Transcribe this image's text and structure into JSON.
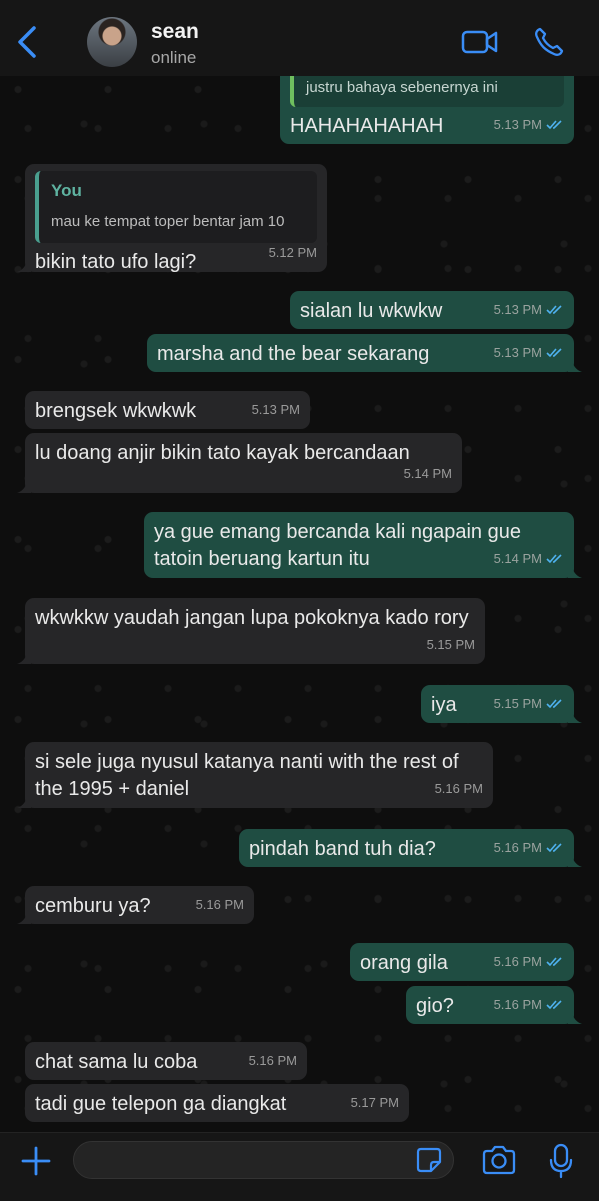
{
  "header": {
    "contact_name": "sean",
    "contact_status": "online"
  },
  "colors": {
    "accent": "#3a8df6",
    "outgoing_bubble": "#1f4d42",
    "incoming_bubble": "#262628",
    "read_ticks": "#4fb2f0"
  },
  "messages": [
    {
      "dir": "out",
      "quote": "justru bahaya sebenernya ini",
      "text": "HAHAHAHAHAH",
      "time": "5.13 PM",
      "status": "read"
    },
    {
      "dir": "in",
      "quote_author": "You",
      "quote": "mau ke tempat toper bentar jam 10",
      "text": "bikin tato ufo lagi?",
      "time": "5.12 PM"
    },
    {
      "dir": "out",
      "text": "sialan lu wkwkw",
      "time": "5.13 PM",
      "status": "read"
    },
    {
      "dir": "out",
      "text": "marsha and the bear sekarang",
      "time": "5.13 PM",
      "status": "read"
    },
    {
      "dir": "in",
      "text": "brengsek wkwkwk",
      "time": "5.13 PM"
    },
    {
      "dir": "in",
      "text": "lu doang anjir bikin tato kayak bercandaan",
      "time": "5.14 PM"
    },
    {
      "dir": "out",
      "text": "ya gue emang bercanda kali ngapain gue tatoin beruang kartun itu",
      "time": "5.14 PM",
      "status": "read"
    },
    {
      "dir": "in",
      "text": "wkwkkw yaudah jangan lupa pokoknya kado rory",
      "time": "5.15 PM"
    },
    {
      "dir": "out",
      "text": "iya",
      "time": "5.15 PM",
      "status": "read"
    },
    {
      "dir": "in",
      "text": "si sele juga nyusul katanya nanti with the rest of the 1995 + daniel",
      "time": "5.16 PM"
    },
    {
      "dir": "out",
      "text": "pindah band tuh dia?",
      "time": "5.16 PM",
      "status": "read"
    },
    {
      "dir": "in",
      "text": "cemburu ya?",
      "time": "5.16 PM"
    },
    {
      "dir": "out",
      "text": "orang gila",
      "time": "5.16 PM",
      "status": "read"
    },
    {
      "dir": "out",
      "text": "gio?",
      "time": "5.16 PM",
      "status": "read"
    },
    {
      "dir": "in",
      "text": "chat sama lu coba",
      "time": "5.16 PM"
    },
    {
      "dir": "in",
      "text": "tadi gue telepon ga diangkat",
      "time": "5.17 PM"
    }
  ],
  "icons": {
    "back": "chevron-left-icon",
    "video": "video-camera-icon",
    "call": "phone-icon",
    "plus": "plus-icon",
    "sticker": "sticker-icon",
    "camera": "camera-icon",
    "mic": "microphone-icon"
  }
}
